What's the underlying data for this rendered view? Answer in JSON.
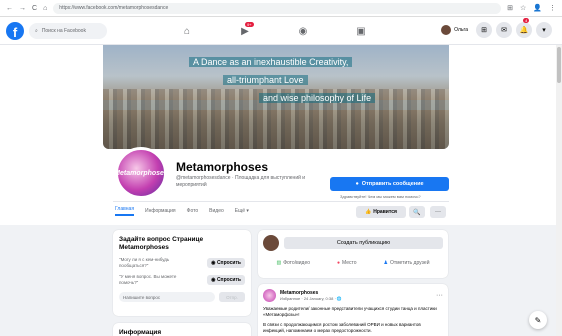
{
  "browser": {
    "url": "https://www.facebook.com/metamorphosesdance",
    "back_icon": "←",
    "forward_icon": "→",
    "reload_icon": "C",
    "home_icon": "⌂",
    "right_icons": [
      "⊞",
      "☆",
      "👤",
      "⋮"
    ]
  },
  "facebook_bar": {
    "logo": "f",
    "search_placeholder": "Поиск на Facebook",
    "notification_badge": "9+",
    "notification_count": "4",
    "user_name": "Ольга"
  },
  "cover": {
    "quote_line1": "A Dance as an inexhaustible Creativity,",
    "quote_line2": "all-triumphant Love",
    "quote_line3": "and wise philosophy of Life"
  },
  "profile": {
    "logo_text": "Metamorphoses",
    "name": "Metamorphoses",
    "subtitle": "@metamorphosesdance · Площадка для выступлений и мероприятий",
    "message_button": "Отправить сообщение",
    "message_note": "Здравствуйте! Чем мы можем вам помочь?"
  },
  "tabs": [
    {
      "label": "Главная",
      "active": true
    },
    {
      "label": "Информация",
      "active": false
    },
    {
      "label": "Фото",
      "active": false
    },
    {
      "label": "Видео",
      "active": false
    },
    {
      "label": "Ещё ▾",
      "active": false
    }
  ],
  "actions": {
    "like_label": "Нравится",
    "search_icon": "🔍",
    "more_icon": "···"
  },
  "ask_card": {
    "title": "Задайте вопрос Странице Metamorphoses",
    "q1": "\"Могу ли я с кем-нибудь пообщаться?\"",
    "q2": "\"У меня вопрос. Вы можете помочь?\"",
    "ask_button": "Спросить",
    "input_placeholder": "Напишите вопрос",
    "send_label": "Отпр."
  },
  "info_card": {
    "title": "Информация"
  },
  "create_card": {
    "create_label": "Создать публикацию",
    "photo_label": "Фото/видео",
    "place_label": "Место",
    "tag_label": "Отметить друзей"
  },
  "post": {
    "author": "Metamorphoses",
    "meta": "Избранное · 24 January, 0:38 · 🌐",
    "text1": "Уважаемые родители/ законные представители учащихся студии танца и пластики «Метаморфозы»!",
    "text2": "В связи с продолжающимся ростом заболеваний ОРВИ и новых вариантов инфекций, напоминаем о мерах предосторожности."
  }
}
